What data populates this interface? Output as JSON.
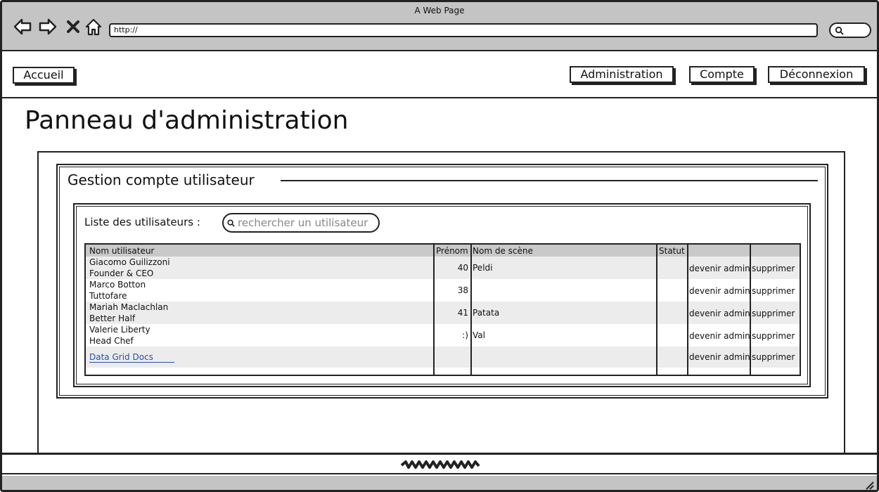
{
  "window": {
    "title": "A Web Page",
    "url": "http://"
  },
  "nav": {
    "home": "Accueil",
    "admin": "Administration",
    "account": "Compte",
    "logout": "Déconnexion"
  },
  "page": {
    "title": "Panneau d'administration"
  },
  "group": {
    "title": "Gestion compte utilisateur"
  },
  "users": {
    "list_label": "Liste des utilisateurs :",
    "search_placeholder": "rechercher un utilisateur",
    "columns": [
      "Nom utilisateur",
      "Prénom",
      "Nom de scène",
      "Statut",
      "",
      ""
    ],
    "rows": [
      {
        "name": "Giacomo Guilizzoni",
        "subtitle": "Founder & CEO",
        "prenom": "40",
        "scene": "Peldi",
        "statut": "",
        "action1": "devenir admin",
        "action2": "supprimer"
      },
      {
        "name": "Marco Botton",
        "subtitle": "Tuttofare",
        "prenom": "38",
        "scene": "",
        "statut": "",
        "action1": "devenir admin",
        "action2": "supprimer"
      },
      {
        "name": "Mariah Maclachlan",
        "subtitle": "Better Half",
        "prenom": "41",
        "scene": "Patata",
        "statut": "",
        "action1": "devenir admin",
        "action2": "supprimer"
      },
      {
        "name": "Valerie Liberty",
        "subtitle": "Head Chef",
        "prenom": ":)",
        "scene": "Val",
        "statut": "",
        "action1": "devenir admin",
        "action2": "supprimer"
      }
    ],
    "link_row": {
      "link": "Data Grid Docs",
      "action1": "devenir admin",
      "action2": "supprimer"
    }
  },
  "icons": {
    "back": "arrow-left-icon",
    "forward": "arrow-right-icon",
    "stop": "close-icon",
    "home": "home-icon",
    "search": "search-icon"
  }
}
